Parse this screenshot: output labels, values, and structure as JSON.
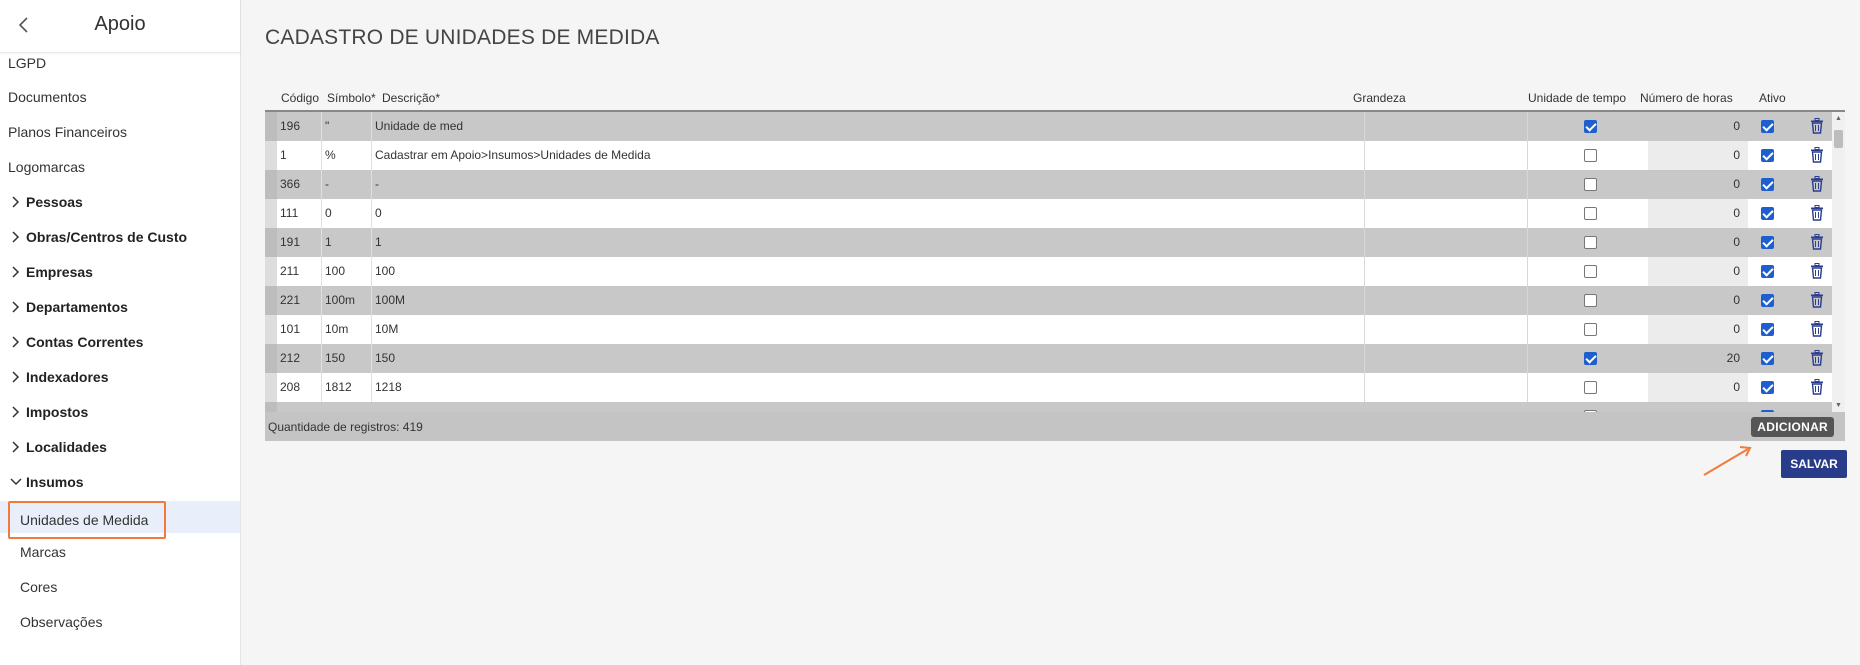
{
  "sidebar": {
    "title": "Apoio",
    "items": [
      {
        "label": "LGPD",
        "kind": "plain"
      },
      {
        "label": "Documentos",
        "kind": "plain"
      },
      {
        "label": "Planos Financeiros",
        "kind": "plain"
      },
      {
        "label": "Logomarcas",
        "kind": "plain"
      },
      {
        "label": "Pessoas",
        "kind": "group"
      },
      {
        "label": "Obras/Centros de Custo",
        "kind": "group"
      },
      {
        "label": "Empresas",
        "kind": "group"
      },
      {
        "label": "Departamentos",
        "kind": "group"
      },
      {
        "label": "Contas Correntes",
        "kind": "group"
      },
      {
        "label": "Indexadores",
        "kind": "group"
      },
      {
        "label": "Impostos",
        "kind": "group"
      },
      {
        "label": "Localidades",
        "kind": "group"
      },
      {
        "label": "Insumos",
        "kind": "group-open"
      },
      {
        "label": "Unidades de Medida",
        "kind": "sub-active"
      },
      {
        "label": "Marcas",
        "kind": "sub"
      },
      {
        "label": "Cores",
        "kind": "sub"
      },
      {
        "label": "Observações",
        "kind": "sub"
      }
    ]
  },
  "page": {
    "title": "CADASTRO DE UNIDADES DE MEDIDA"
  },
  "table": {
    "headers": {
      "codigo": "Código",
      "simbolo": "Símbolo*",
      "descricao": "Descrição*",
      "grandeza": "Grandeza",
      "unidade_tempo": "Unidade de tempo",
      "numero_horas": "Número de horas",
      "ativo": "Ativo"
    },
    "rows": [
      {
        "codigo": "196",
        "simbolo": "\"",
        "descricao": "Unidade de med",
        "grandeza": "",
        "unidade_tempo": true,
        "numero_horas": "0",
        "ativo": true
      },
      {
        "codigo": "1",
        "simbolo": "%",
        "descricao": "Cadastrar em Apoio>Insumos>Unidades de Medida",
        "grandeza": "",
        "unidade_tempo": false,
        "numero_horas": "0",
        "ativo": true
      },
      {
        "codigo": "366",
        "simbolo": "-",
        "descricao": "-",
        "grandeza": "",
        "unidade_tempo": false,
        "numero_horas": "0",
        "ativo": true
      },
      {
        "codigo": "111",
        "simbolo": "0",
        "descricao": "0",
        "grandeza": "",
        "unidade_tempo": false,
        "numero_horas": "0",
        "ativo": true
      },
      {
        "codigo": "191",
        "simbolo": "1",
        "descricao": "1",
        "grandeza": "",
        "unidade_tempo": false,
        "numero_horas": "0",
        "ativo": true
      },
      {
        "codigo": "211",
        "simbolo": "100",
        "descricao": "100",
        "grandeza": "",
        "unidade_tempo": false,
        "numero_horas": "0",
        "ativo": true
      },
      {
        "codigo": "221",
        "simbolo": "100m",
        "descricao": "100M",
        "grandeza": "",
        "unidade_tempo": false,
        "numero_horas": "0",
        "ativo": true
      },
      {
        "codigo": "101",
        "simbolo": "10m",
        "descricao": "10M",
        "grandeza": "",
        "unidade_tempo": false,
        "numero_horas": "0",
        "ativo": true
      },
      {
        "codigo": "212",
        "simbolo": "150",
        "descricao": "150",
        "grandeza": "",
        "unidade_tempo": true,
        "numero_horas": "20",
        "ativo": true
      },
      {
        "codigo": "208",
        "simbolo": "1812",
        "descricao": "1218",
        "grandeza": "",
        "unidade_tempo": false,
        "numero_horas": "0",
        "ativo": true
      }
    ],
    "footer": {
      "count_label": "Quantidade de registros:",
      "count_value": "419"
    }
  },
  "buttons": {
    "add": "ADICIONAR",
    "save": "SALVAR"
  },
  "colors": {
    "save_button": "#283c8a",
    "add_button": "#555555",
    "checkbox_on": "#1e5fd0",
    "highlight": "#f07b3c",
    "delete_icon": "#2a3d8f"
  }
}
